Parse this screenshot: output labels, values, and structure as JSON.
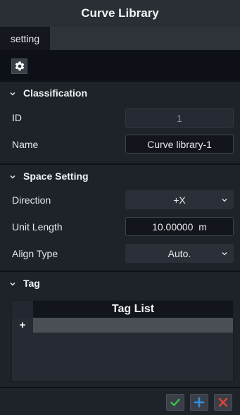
{
  "window": {
    "title": "Curve Library"
  },
  "tabs": [
    {
      "label": "setting"
    }
  ],
  "toolbar": {
    "settings_icon": "gear-icon"
  },
  "classification": {
    "title": "Classification",
    "id_label": "ID",
    "id_value": "1",
    "name_label": "Name",
    "name_value": "Curve library-1"
  },
  "space_setting": {
    "title": "Space Setting",
    "direction_label": "Direction",
    "direction_value": "+X",
    "unit_length_label": "Unit Length",
    "unit_length_value": "10.00000  m",
    "align_type_label": "Align Type",
    "align_type_value": "Auto."
  },
  "tag": {
    "title": "Tag",
    "list_header": "Tag List",
    "add_symbol": "+"
  },
  "footer": {
    "confirm_icon": "check-icon",
    "add_icon": "plus-icon",
    "close_icon": "close-icon"
  },
  "colors": {
    "confirm": "#3cc24a",
    "add": "#2f8fe0",
    "close": "#e0443a"
  }
}
